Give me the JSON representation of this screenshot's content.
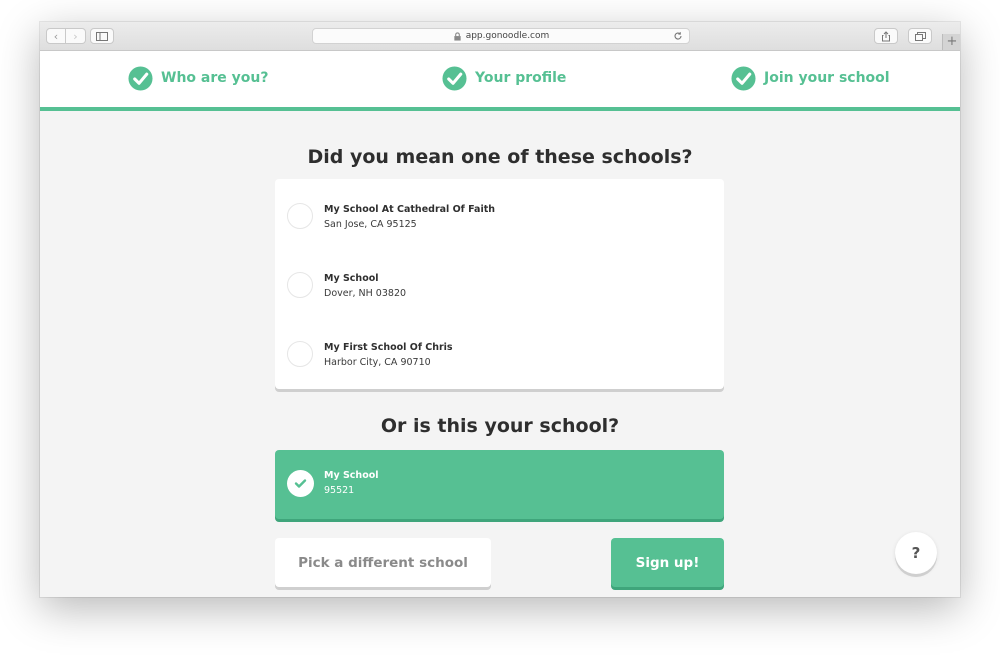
{
  "browser": {
    "url": "app.gonoodle.com",
    "new_tab_label": "+"
  },
  "stepper": {
    "steps": [
      {
        "label": "Who are you?"
      },
      {
        "label": "Your profile"
      },
      {
        "label": "Join your school"
      }
    ]
  },
  "suggestions": {
    "heading": "Did you mean one of these schools?",
    "schools": [
      {
        "name": "My School At Cathedral Of Faith",
        "location": "San Jose, CA 95125"
      },
      {
        "name": "My School",
        "location": "Dover, NH 03820"
      },
      {
        "name": "My First School Of Chris",
        "location": "Harbor City, CA 90710"
      }
    ]
  },
  "current": {
    "heading": "Or is this your school?",
    "school": {
      "name": "My School",
      "zip": "95521"
    }
  },
  "actions": {
    "pick_different_label": "Pick a different school",
    "sign_up_label": "Sign up!"
  },
  "help": {
    "label": "?"
  },
  "colors": {
    "brand_green": "#56c093",
    "background": "#f4f4f4"
  }
}
